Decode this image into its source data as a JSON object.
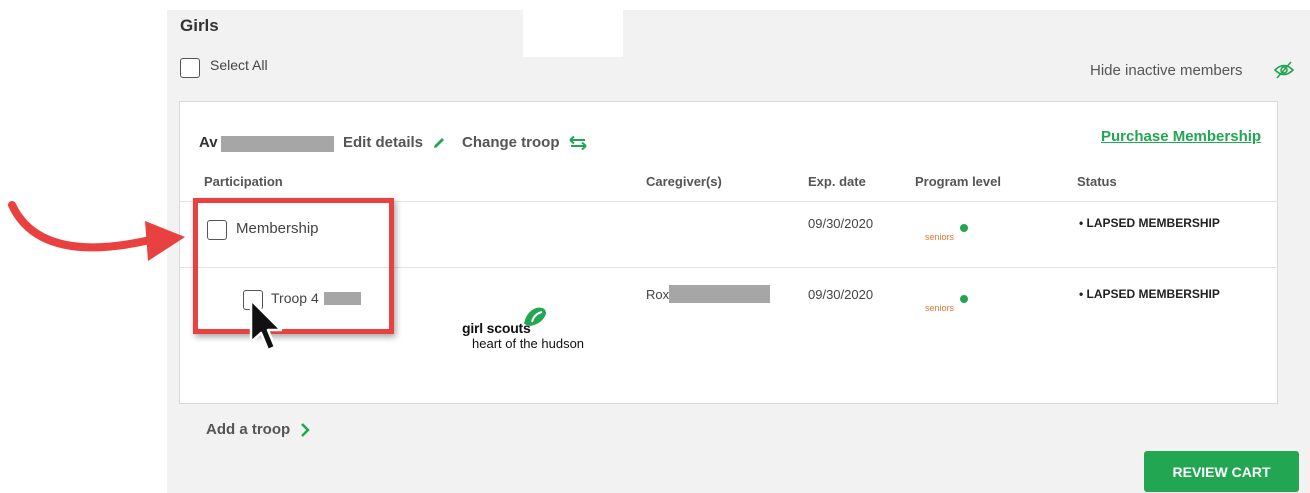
{
  "section": {
    "title": "Girls",
    "select_all": "Select All",
    "hide_inactive": "Hide inactive members"
  },
  "member": {
    "name_prefix": "Av",
    "edit_details": "Edit details",
    "change_troop": "Change troop",
    "purchase": "Purchase Membership"
  },
  "table": {
    "headers": [
      "Participation",
      "Caregiver(s)",
      "Exp. date",
      "Program level",
      "Status"
    ],
    "rows": [
      {
        "participation": "Membership",
        "caregiver": "",
        "exp_date": "09/30/2020",
        "program_level": "seniors",
        "status": "• LAPSED MEMBERSHIP"
      },
      {
        "participation": "Troop 4",
        "caregiver": "Rox",
        "exp_date": "09/30/2020",
        "program_level": "seniors",
        "status": "• LAPSED MEMBERSHIP"
      }
    ]
  },
  "logo": {
    "line1": "girl scouts",
    "line2": "heart of the hudson"
  },
  "add_troop": "Add a troop",
  "review_cart": "REVIEW CART",
  "colors": {
    "accent_green": "#22a651",
    "annotation_red": "#e9413f",
    "seniors_orange": "#e8772e"
  },
  "icons": [
    "eye-slash-icon",
    "pencil-icon",
    "swap-arrows-icon",
    "chevron-right-icon",
    "cursor-pointer-icon",
    "curved-arrow-icon",
    "trefoil-icon"
  ]
}
